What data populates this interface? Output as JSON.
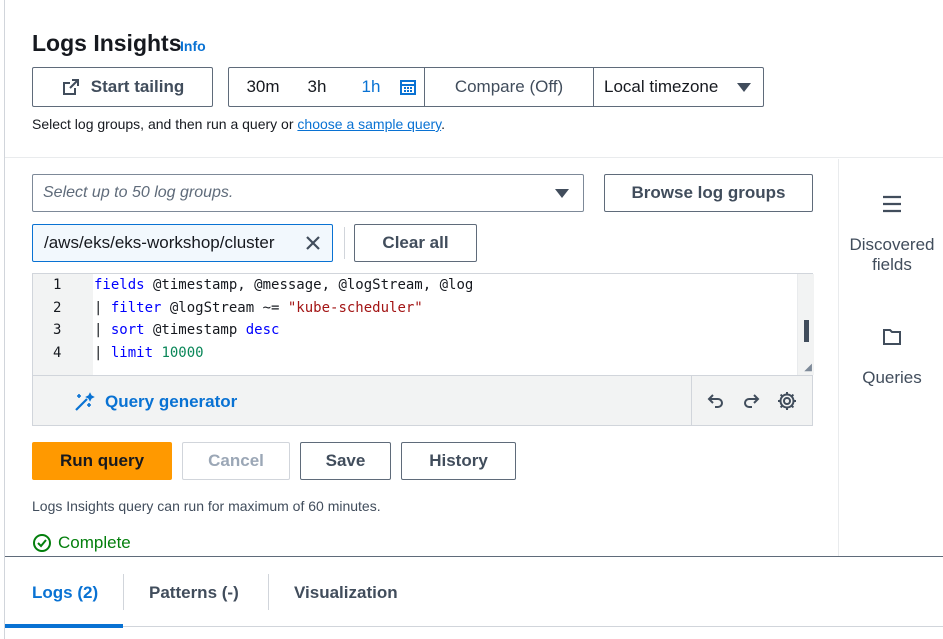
{
  "header": {
    "title": "Logs Insights",
    "info_link": "Info",
    "start_tailing": "Start tailing",
    "range_30m": "30m",
    "range_3h": "3h",
    "range_1h": "1h",
    "compare": "Compare (Off)",
    "timezone": "Local timezone",
    "hint_text": "Select log groups, and then run a query or ",
    "hint_link": "choose a sample query",
    "hint_end": "."
  },
  "log_groups": {
    "placeholder": "Select up to 50 log groups.",
    "browse_button": "Browse log groups",
    "selected_token": "/aws/eks/eks-workshop/cluster",
    "clear_all": "Clear all"
  },
  "editor": {
    "line_numbers": [
      "1",
      "2",
      "3",
      "4"
    ],
    "line1_cmd": "fields",
    "line1_rest": " @timestamp, @message, @logStream, @log",
    "line2_pipe": "| ",
    "line2_cmd": "filter",
    "line2_field": " @logStream ~= ",
    "line2_str": "\"kube-scheduler\"",
    "line3_pipe": "| ",
    "line3_cmd": "sort",
    "line3_field": " @timestamp ",
    "line3_kw": "desc",
    "line4_pipe": "| ",
    "line4_cmd": "limit",
    "line4_num": " 10000",
    "query_generator": "Query generator"
  },
  "actions": {
    "run_query": "Run query",
    "cancel": "Cancel",
    "save": "Save",
    "history": "History",
    "note": "Logs Insights query can run for maximum of 60 minutes.",
    "status": "Complete"
  },
  "side_panel": {
    "discovered_line1": "Discovered",
    "discovered_line2": "fields",
    "queries": "Queries"
  },
  "tabs": {
    "logs": "Logs (2)",
    "patterns": "Patterns (-)",
    "visualization": "Visualization"
  },
  "colors": {
    "accent": "#0972d3",
    "primary_button": "#ff9900",
    "success": "#037f0c"
  }
}
